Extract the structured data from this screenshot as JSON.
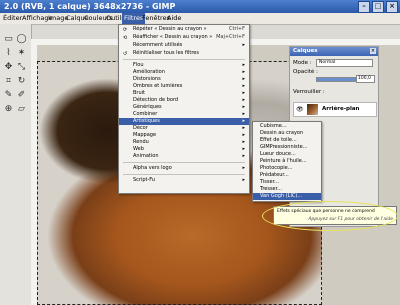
{
  "window": {
    "title": "2.0 (RVB, 1 calque) 3648x2736 - GIMP"
  },
  "menubar": {
    "items": [
      "Éditer",
      "Affichage",
      "Image",
      "Calque",
      "Couleurs",
      "Outils",
      "Filtres",
      "Fenêtres",
      "Aide"
    ],
    "active": "Filtres"
  },
  "filters_menu": {
    "repeat": {
      "label": "Répéter « Dessin au crayon »",
      "shortcut": "Ctrl+F"
    },
    "reshow": {
      "label": "Réafficher « Dessin au crayon »",
      "shortcut": "Maj+Ctrl+F"
    },
    "recent": {
      "label": "Récemment utilisés"
    },
    "reset": {
      "label": "Réinitialiser tous les filtres"
    },
    "items": [
      {
        "label": "Flou"
      },
      {
        "label": "Amélioration"
      },
      {
        "label": "Distorsions"
      },
      {
        "label": "Ombres et lumières"
      },
      {
        "label": "Bruit"
      },
      {
        "label": "Détection de bord"
      },
      {
        "label": "Génériques"
      },
      {
        "label": "Combiner"
      },
      {
        "label": "Artistiques"
      },
      {
        "label": "Décor"
      },
      {
        "label": "Mappage"
      },
      {
        "label": "Rendu"
      },
      {
        "label": "Web"
      },
      {
        "label": "Animation"
      }
    ],
    "alpha_logo": {
      "label": "Alpha vers logo"
    },
    "script_fu": {
      "label": "Script-Fu"
    }
  },
  "artistic_submenu": {
    "items": [
      {
        "label": "Cubisme..."
      },
      {
        "label": "Dessin au crayon"
      },
      {
        "label": "Effet de toile..."
      },
      {
        "label": "GIMPressionniste..."
      },
      {
        "label": "Lueur douce..."
      },
      {
        "label": "Peinture à l'huile..."
      },
      {
        "label": "Photocopie..."
      },
      {
        "label": "Prédateur..."
      },
      {
        "label": "Tisser..."
      },
      {
        "label": "Tresser..."
      },
      {
        "label": "Van Gogh (LIC)..."
      }
    ],
    "selected": "Van Gogh (LIC)..."
  },
  "tooltip": {
    "line1": "Effets spéciaux que personne ne comprend",
    "line2": "Appuyez sur F1 pour obtenir de l'aide"
  },
  "layers_panel": {
    "title": "Calques",
    "mode_label": "Mode :",
    "mode_value": "Normal",
    "opacity_label": "Opacité :",
    "opacity_value": "100,0",
    "lock_label": "Verrouiller :",
    "layer_name": "Arrière-plan"
  },
  "colors": {
    "menu_highlight": "#3a5fa8",
    "title_bar": "#2a5aa8",
    "tooltip_bg": "#ffffe1",
    "annotation": "#e7e35a"
  }
}
